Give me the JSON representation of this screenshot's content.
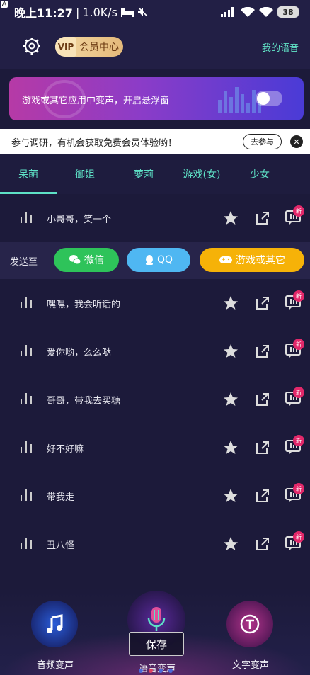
{
  "status_bar": {
    "time": "晚上11:27",
    "speed": "1.0K/s",
    "battery": "38"
  },
  "header": {
    "vip_tag": "VIP",
    "vip_label": "会员中心",
    "my_voice": "我的语音"
  },
  "banner": {
    "text": "游戏或其它应用中变声，开启悬浮窗",
    "toggle_on": false
  },
  "survey": {
    "text": "参与调研，有机会获取免费会员体验哟！",
    "join_label": "去参与",
    "close_symbol": "✕"
  },
  "tabs": [
    {
      "label": "呆萌",
      "active": true
    },
    {
      "label": "御姐",
      "active": false
    },
    {
      "label": "萝莉",
      "active": false
    },
    {
      "label": "游戏(女)",
      "active": false
    },
    {
      "label": "少女",
      "active": false
    }
  ],
  "send_bar": {
    "label": "发送至",
    "wechat": "微信",
    "qq": "QQ",
    "game": "游戏或其它"
  },
  "voices": [
    {
      "title": "小哥哥，笑一个",
      "badge": "新"
    },
    {
      "title": "嘿嘿，我会听话的",
      "badge": "新"
    },
    {
      "title": "爱你哟，么么哒",
      "badge": "新"
    },
    {
      "title": "哥哥，带我去买糖",
      "badge": "新"
    },
    {
      "title": "好不好嘛",
      "badge": "新"
    },
    {
      "title": "带我走",
      "badge": "新"
    },
    {
      "title": "丑八怪",
      "badge": "新"
    }
  ],
  "bottom_nav": {
    "audio_label": "音频变声",
    "voice_label": "语音变声",
    "text_label": "文字变声",
    "save_label": "保存"
  },
  "colors": {
    "accent": "#5ee1c6",
    "background": "#1c1a3a",
    "badge": "#e2286a",
    "wechat": "#2ec35a",
    "qq": "#4fb7f2",
    "game": "#f6b208"
  }
}
